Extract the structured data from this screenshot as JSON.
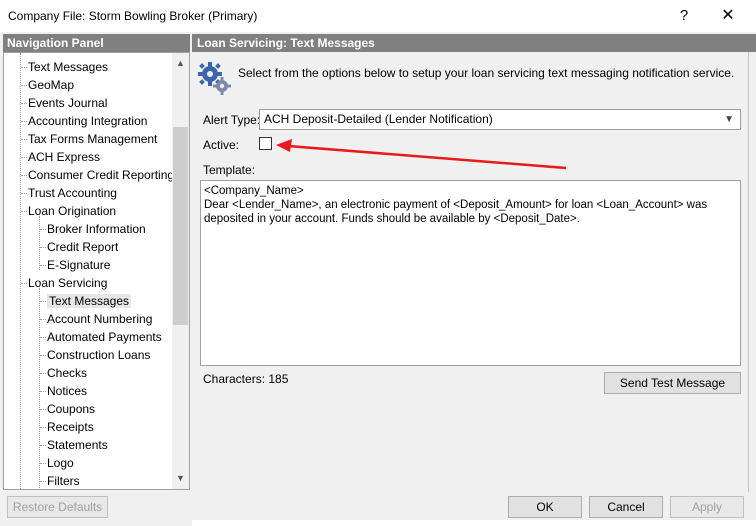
{
  "window": {
    "title": "Company File: Storm Bowling Broker (Primary)",
    "help": "?",
    "close": "✕"
  },
  "nav": {
    "header": "Navigation Panel",
    "items": [
      {
        "label": "Text Messages",
        "level": 1
      },
      {
        "label": "GeoMap",
        "level": 1
      },
      {
        "label": "Events Journal",
        "level": 1
      },
      {
        "label": "Accounting Integration",
        "level": 1
      },
      {
        "label": "Tax Forms Management",
        "level": 1
      },
      {
        "label": "ACH Express",
        "level": 1
      },
      {
        "label": "Consumer Credit Reporting",
        "level": 1
      },
      {
        "label": "Trust Accounting",
        "level": 1
      },
      {
        "label": "Loan Origination",
        "level": 1
      },
      {
        "label": "Broker Information",
        "level": 2
      },
      {
        "label": "Credit Report",
        "level": 2
      },
      {
        "label": "E-Signature",
        "level": 2
      },
      {
        "label": "Loan Servicing",
        "level": 1
      },
      {
        "label": "Text Messages",
        "level": 2,
        "selected": true
      },
      {
        "label": "Account Numbering",
        "level": 2
      },
      {
        "label": "Automated Payments",
        "level": 2
      },
      {
        "label": "Construction Loans",
        "level": 2
      },
      {
        "label": "Checks",
        "level": 2
      },
      {
        "label": "Notices",
        "level": 2
      },
      {
        "label": "Coupons",
        "level": 2
      },
      {
        "label": "Receipts",
        "level": 2
      },
      {
        "label": "Statements",
        "level": 2
      },
      {
        "label": "Logo",
        "level": 2
      },
      {
        "label": "Filters",
        "level": 2
      }
    ],
    "scroll_up": "▲",
    "scroll_down": "▼"
  },
  "panel": {
    "header": "Loan Servicing: Text Messages",
    "intro": "Select from the options below to setup your loan servicing text messaging notification service.",
    "icon": "gears-icon",
    "alert_type_label": "Alert Type:",
    "alert_type_value": "ACH Deposit-Detailed (Lender Notification)",
    "select_arrow": "▼",
    "active_label": "Active:",
    "active_checked": false,
    "template_label": "Template:",
    "template_text": "<Company_Name>\nDear <Lender_Name>, an electronic payment of <Deposit_Amount> for loan <Loan_Account> was deposited in your account. Funds should be available by <Deposit_Date>.",
    "characters_label": "Characters: 185",
    "send_test_label": "Send Test Message"
  },
  "footer": {
    "restore_defaults": "Restore Defaults",
    "ok": "OK",
    "cancel": "Cancel",
    "apply": "Apply"
  },
  "colors": {
    "header_bg": "#808080",
    "annotation_arrow": "#e8191a"
  }
}
